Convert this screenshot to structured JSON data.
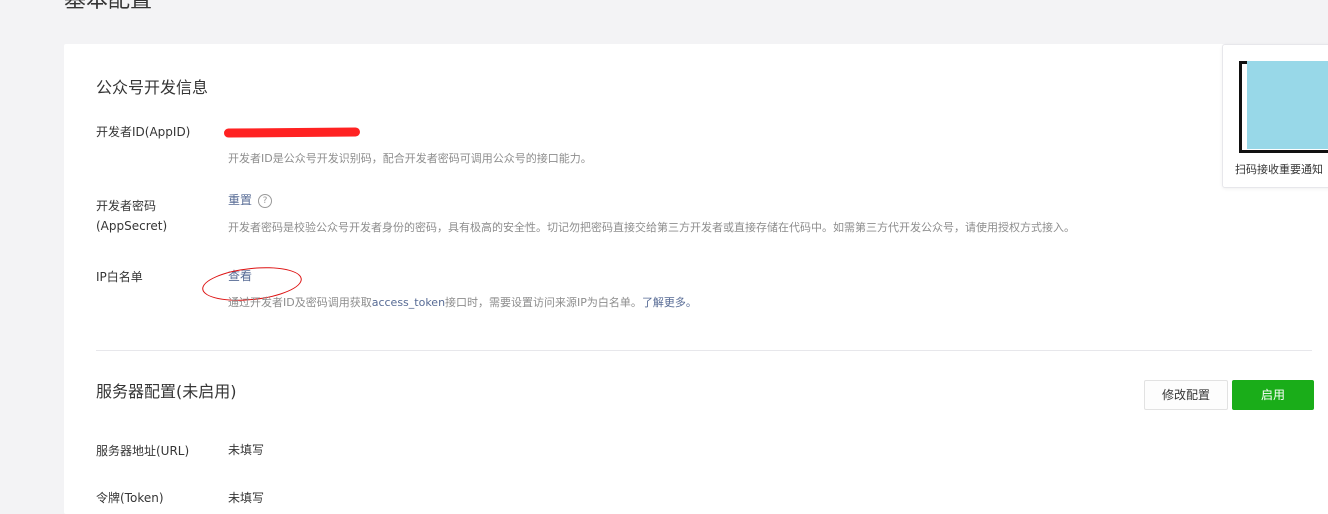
{
  "page": {
    "title": "基本配置"
  },
  "dev_info": {
    "title": "公众号开发信息",
    "appid": {
      "label": "开发者ID(AppID)",
      "desc": "开发者ID是公众号开发识别码，配合开发者密码可调用公众号的接口能力。"
    },
    "secret": {
      "label_line1": "开发者密码",
      "label_line2": "(AppSecret)",
      "action": "重置",
      "help": "?",
      "desc": "开发者密码是校验公众号开发者身份的密码，具有极高的安全性。切记勿把密码直接交给第三方开发者或直接存储在代码中。如需第三方代开发公众号，请使用授权方式接入。"
    },
    "ip_whitelist": {
      "label": "IP白名单",
      "action": "查看",
      "desc_prefix": "通过开发者ID及密码调用获取",
      "desc_token": "access_token",
      "desc_suffix": "接口时，需要设置访问来源IP为白名单。",
      "learn_more": "了解更多。"
    }
  },
  "server_config": {
    "title": "服务器配置(未启用)",
    "modify_button": "修改配置",
    "enable_button": "启用",
    "url": {
      "label": "服务器地址(URL)",
      "value": "未填写"
    },
    "token": {
      "label": "令牌(Token)",
      "value": "未填写"
    }
  },
  "qr_panel": {
    "caption": "扫码接收重要通知"
  },
  "colors": {
    "primary": "#1aad19",
    "link": "#576b95",
    "annotation": "#d11111",
    "redaction": "#ff2222"
  }
}
